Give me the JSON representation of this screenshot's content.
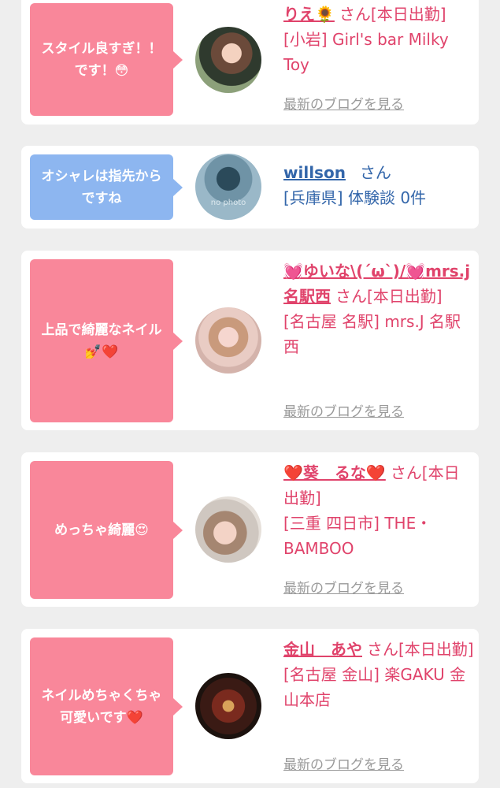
{
  "comments": [
    {
      "bubble_text": "スタイル良すぎ！！です！😳",
      "name": "りえ🌻",
      "san_suffix": "さん[本日出勤]",
      "shop": "[小岩] Girl's bar Milky Toy",
      "blog_link": "最新のブログを見る"
    },
    {
      "bubble_text": "オシャレは指先からですね",
      "name": "willson",
      "san_suffix": "さん",
      "shop": "[兵庫県] 体験談 0件",
      "avatar_text": "no photo"
    },
    {
      "bubble_text": "上品で綺麗なネイル💅❤️",
      "name": "💓ゆいな\\(´ω`)/💓mrs.j名駅西",
      "san_suffix": "さん[本日出勤]",
      "shop": "[名古屋 名駅] mrs.J 名駅西",
      "blog_link": "最新のブログを見る"
    },
    {
      "bubble_text": "めっちゃ綺麗😍",
      "name": "❤️葵　るな❤️",
      "san_suffix": "さん[本日出勤]",
      "shop": "[三重 四日市] THE・BAMBOO",
      "blog_link": "最新のブログを見る"
    },
    {
      "bubble_text": "ネイルめちゃくちゃ可愛いです❤️",
      "name": "金山　あや",
      "san_suffix": "さん[本日出勤]",
      "shop": "[名古屋 金山] 楽GAKU 金山本店",
      "blog_link": "最新のブログを見る"
    }
  ],
  "colors": {
    "accent_pink": "#e0436b",
    "bubble_pink": "#f9879a",
    "bubble_blue": "#8db6f0",
    "link_blue": "#3366aa"
  }
}
